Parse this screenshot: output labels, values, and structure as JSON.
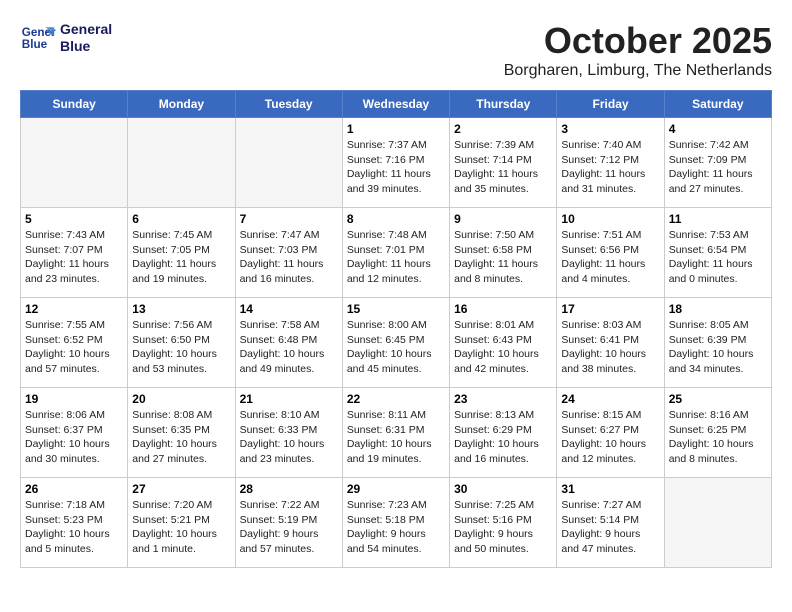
{
  "header": {
    "logo_line1": "General",
    "logo_line2": "Blue",
    "month": "October 2025",
    "location": "Borgharen, Limburg, The Netherlands"
  },
  "weekdays": [
    "Sunday",
    "Monday",
    "Tuesday",
    "Wednesday",
    "Thursday",
    "Friday",
    "Saturday"
  ],
  "weeks": [
    [
      {
        "day": "",
        "info": ""
      },
      {
        "day": "",
        "info": ""
      },
      {
        "day": "",
        "info": ""
      },
      {
        "day": "1",
        "info": "Sunrise: 7:37 AM\nSunset: 7:16 PM\nDaylight: 11 hours\nand 39 minutes."
      },
      {
        "day": "2",
        "info": "Sunrise: 7:39 AM\nSunset: 7:14 PM\nDaylight: 11 hours\nand 35 minutes."
      },
      {
        "day": "3",
        "info": "Sunrise: 7:40 AM\nSunset: 7:12 PM\nDaylight: 11 hours\nand 31 minutes."
      },
      {
        "day": "4",
        "info": "Sunrise: 7:42 AM\nSunset: 7:09 PM\nDaylight: 11 hours\nand 27 minutes."
      }
    ],
    [
      {
        "day": "5",
        "info": "Sunrise: 7:43 AM\nSunset: 7:07 PM\nDaylight: 11 hours\nand 23 minutes."
      },
      {
        "day": "6",
        "info": "Sunrise: 7:45 AM\nSunset: 7:05 PM\nDaylight: 11 hours\nand 19 minutes."
      },
      {
        "day": "7",
        "info": "Sunrise: 7:47 AM\nSunset: 7:03 PM\nDaylight: 11 hours\nand 16 minutes."
      },
      {
        "day": "8",
        "info": "Sunrise: 7:48 AM\nSunset: 7:01 PM\nDaylight: 11 hours\nand 12 minutes."
      },
      {
        "day": "9",
        "info": "Sunrise: 7:50 AM\nSunset: 6:58 PM\nDaylight: 11 hours\nand 8 minutes."
      },
      {
        "day": "10",
        "info": "Sunrise: 7:51 AM\nSunset: 6:56 PM\nDaylight: 11 hours\nand 4 minutes."
      },
      {
        "day": "11",
        "info": "Sunrise: 7:53 AM\nSunset: 6:54 PM\nDaylight: 11 hours\nand 0 minutes."
      }
    ],
    [
      {
        "day": "12",
        "info": "Sunrise: 7:55 AM\nSunset: 6:52 PM\nDaylight: 10 hours\nand 57 minutes."
      },
      {
        "day": "13",
        "info": "Sunrise: 7:56 AM\nSunset: 6:50 PM\nDaylight: 10 hours\nand 53 minutes."
      },
      {
        "day": "14",
        "info": "Sunrise: 7:58 AM\nSunset: 6:48 PM\nDaylight: 10 hours\nand 49 minutes."
      },
      {
        "day": "15",
        "info": "Sunrise: 8:00 AM\nSunset: 6:45 PM\nDaylight: 10 hours\nand 45 minutes."
      },
      {
        "day": "16",
        "info": "Sunrise: 8:01 AM\nSunset: 6:43 PM\nDaylight: 10 hours\nand 42 minutes."
      },
      {
        "day": "17",
        "info": "Sunrise: 8:03 AM\nSunset: 6:41 PM\nDaylight: 10 hours\nand 38 minutes."
      },
      {
        "day": "18",
        "info": "Sunrise: 8:05 AM\nSunset: 6:39 PM\nDaylight: 10 hours\nand 34 minutes."
      }
    ],
    [
      {
        "day": "19",
        "info": "Sunrise: 8:06 AM\nSunset: 6:37 PM\nDaylight: 10 hours\nand 30 minutes."
      },
      {
        "day": "20",
        "info": "Sunrise: 8:08 AM\nSunset: 6:35 PM\nDaylight: 10 hours\nand 27 minutes."
      },
      {
        "day": "21",
        "info": "Sunrise: 8:10 AM\nSunset: 6:33 PM\nDaylight: 10 hours\nand 23 minutes."
      },
      {
        "day": "22",
        "info": "Sunrise: 8:11 AM\nSunset: 6:31 PM\nDaylight: 10 hours\nand 19 minutes."
      },
      {
        "day": "23",
        "info": "Sunrise: 8:13 AM\nSunset: 6:29 PM\nDaylight: 10 hours\nand 16 minutes."
      },
      {
        "day": "24",
        "info": "Sunrise: 8:15 AM\nSunset: 6:27 PM\nDaylight: 10 hours\nand 12 minutes."
      },
      {
        "day": "25",
        "info": "Sunrise: 8:16 AM\nSunset: 6:25 PM\nDaylight: 10 hours\nand 8 minutes."
      }
    ],
    [
      {
        "day": "26",
        "info": "Sunrise: 7:18 AM\nSunset: 5:23 PM\nDaylight: 10 hours\nand 5 minutes."
      },
      {
        "day": "27",
        "info": "Sunrise: 7:20 AM\nSunset: 5:21 PM\nDaylight: 10 hours\nand 1 minute."
      },
      {
        "day": "28",
        "info": "Sunrise: 7:22 AM\nSunset: 5:19 PM\nDaylight: 9 hours\nand 57 minutes."
      },
      {
        "day": "29",
        "info": "Sunrise: 7:23 AM\nSunset: 5:18 PM\nDaylight: 9 hours\nand 54 minutes."
      },
      {
        "day": "30",
        "info": "Sunrise: 7:25 AM\nSunset: 5:16 PM\nDaylight: 9 hours\nand 50 minutes."
      },
      {
        "day": "31",
        "info": "Sunrise: 7:27 AM\nSunset: 5:14 PM\nDaylight: 9 hours\nand 47 minutes."
      },
      {
        "day": "",
        "info": ""
      }
    ]
  ]
}
